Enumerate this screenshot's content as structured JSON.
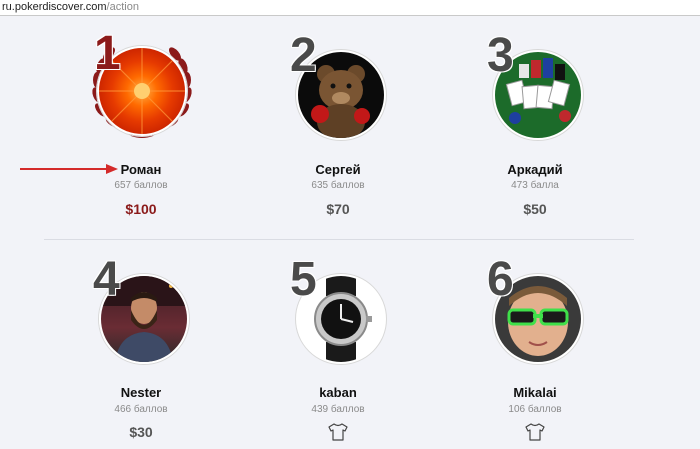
{
  "browser": {
    "url_host": "ru.pokerdiscover.com",
    "url_path": "/action"
  },
  "colors": {
    "first_accent": "#8b1a1a",
    "rank": "#4a4a4a",
    "arrow": "#d42a2a"
  },
  "leaders": [
    {
      "rank": "1",
      "name": "Роман",
      "points": "657 баллов",
      "prize": "$100",
      "avatar": "red-flower-with-laurel"
    },
    {
      "rank": "2",
      "name": "Сергей",
      "points": "635 баллов",
      "prize": "$70",
      "avatar": "teddy-bear-boxer"
    },
    {
      "rank": "3",
      "name": "Аркадий",
      "points": "473 балла",
      "prize": "$50",
      "avatar": "poker-chips-and-cards"
    },
    {
      "rank": "4",
      "name": "Nester",
      "points": "466 баллов",
      "prize": "$30",
      "avatar": "bearded-man"
    },
    {
      "rank": "5",
      "name": "kaban",
      "points": "439 баллов",
      "prize": "",
      "prize_icon": "tshirt-icon",
      "avatar": "wristwatch"
    },
    {
      "rank": "6",
      "name": "Mikalai",
      "points": "106 баллов",
      "prize": "",
      "prize_icon": "tshirt-icon",
      "avatar": "kid-with-green-glasses"
    }
  ]
}
